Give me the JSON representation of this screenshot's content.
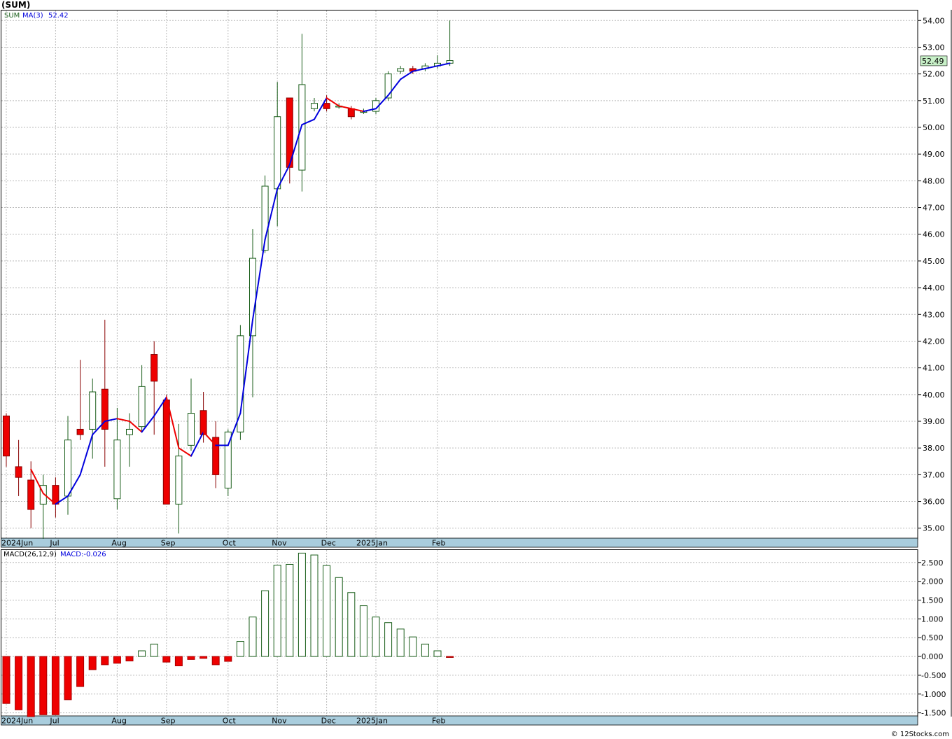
{
  "header": {
    "symbol": "(SUM)",
    "legend_symbol": "SUM",
    "legend_ma": "MA(3)",
    "legend_ma_value": "52.42",
    "last_price": "52.49",
    "macd_label": "MACD(26,12,9)",
    "macd_value_label": "MACD:-0.026"
  },
  "footer": {
    "credit": "© 12Stocks.com"
  },
  "colors": {
    "up_candle": "#ffffff",
    "up_outline": "#1a5e1a",
    "down_candle": "#ee0000",
    "ma_up": "#0000dd",
    "ma_down": "#ee0000",
    "macd_pos_outline": "#1a5e1a",
    "macd_neg": "#ee0000",
    "grid": "#bbbbbb",
    "date_strip": "#a9cddd",
    "last_price_box": "#c8f0c8"
  },
  "chart_data": [
    {
      "type": "candlestick",
      "title": "(SUM)",
      "xticks": [
        "2024Jun",
        "Jul",
        "Aug",
        "Sep",
        "Oct",
        "Nov",
        "Dec",
        "2025Jan",
        "Feb"
      ],
      "xtick_index": [
        0,
        4,
        9,
        13,
        18,
        22,
        26,
        30,
        35
      ],
      "ylim": [
        34.6,
        54.4
      ],
      "yticks": [
        "54.00",
        "53.00",
        "52.00",
        "51.00",
        "50.00",
        "49.00",
        "48.00",
        "47.00",
        "46.00",
        "45.00",
        "44.00",
        "43.00",
        "42.00",
        "41.00",
        "40.00",
        "39.00",
        "38.00",
        "37.00",
        "36.00",
        "35.00"
      ],
      "ohlc": [
        [
          39.2,
          39.3,
          37.3,
          37.7
        ],
        [
          37.3,
          38.3,
          36.2,
          36.9
        ],
        [
          36.8,
          37.5,
          35.0,
          35.7
        ],
        [
          35.9,
          37.0,
          34.6,
          36.6
        ],
        [
          36.6,
          36.9,
          35.4,
          35.9
        ],
        [
          36.2,
          39.2,
          35.5,
          38.3
        ],
        [
          38.7,
          41.3,
          38.3,
          38.5
        ],
        [
          38.7,
          40.6,
          37.6,
          40.1
        ],
        [
          40.2,
          42.8,
          37.3,
          38.7
        ],
        [
          36.1,
          39.5,
          35.7,
          38.3
        ],
        [
          38.5,
          39.3,
          37.3,
          38.7
        ],
        [
          38.8,
          41.1,
          38.6,
          40.3
        ],
        [
          41.5,
          42.0,
          38.5,
          40.5
        ],
        [
          39.8,
          40.0,
          35.9,
          35.9
        ],
        [
          35.9,
          38.9,
          34.8,
          37.7
        ],
        [
          38.1,
          40.6,
          37.9,
          39.3
        ],
        [
          39.4,
          40.1,
          38.2,
          38.5
        ],
        [
          38.4,
          39.0,
          36.5,
          37.0
        ],
        [
          36.5,
          38.7,
          36.2,
          38.6
        ],
        [
          38.6,
          42.6,
          38.3,
          42.2
        ],
        [
          42.2,
          46.2,
          39.9,
          45.1
        ],
        [
          45.4,
          48.2,
          45.3,
          47.8
        ],
        [
          47.7,
          51.7,
          46.3,
          50.4
        ],
        [
          51.1,
          51.1,
          47.9,
          48.5
        ],
        [
          48.4,
          53.5,
          47.6,
          51.6
        ],
        [
          50.7,
          51.1,
          50.6,
          50.9
        ],
        [
          50.9,
          51.2,
          50.6,
          50.7
        ],
        [
          50.8,
          50.9,
          50.7,
          50.8
        ],
        [
          50.7,
          50.8,
          50.3,
          50.4
        ],
        [
          50.6,
          50.7,
          50.5,
          50.6
        ],
        [
          50.6,
          51.1,
          50.5,
          51.0
        ],
        [
          51.1,
          52.1,
          51.0,
          52.0
        ],
        [
          52.1,
          52.3,
          52.0,
          52.2
        ],
        [
          52.2,
          52.3,
          52.0,
          52.1
        ],
        [
          52.2,
          52.4,
          52.1,
          52.3
        ],
        [
          52.3,
          52.7,
          52.2,
          52.4
        ],
        [
          52.4,
          54.0,
          52.3,
          52.5
        ]
      ],
      "ma3": [
        null,
        null,
        37.2,
        36.3,
        35.9,
        36.2,
        37.0,
        38.5,
        39.0,
        39.1,
        39.0,
        38.6,
        39.2,
        39.9,
        38.0,
        37.7,
        38.6,
        38.1,
        38.1,
        39.3,
        42.8,
        45.8,
        47.7,
        48.6,
        50.1,
        50.3,
        51.1,
        50.8,
        50.7,
        50.6,
        50.7,
        51.2,
        51.8,
        52.1,
        52.2,
        52.3,
        52.4
      ]
    },
    {
      "type": "bar",
      "title": "MACD(26,12,9)",
      "xticks": [
        "2024Jun",
        "Jul",
        "Aug",
        "Sep",
        "Oct",
        "Nov",
        "Dec",
        "2025Jan",
        "Feb"
      ],
      "xtick_index": [
        0,
        4,
        9,
        13,
        18,
        22,
        26,
        30,
        35
      ],
      "ylim": [
        -1.6,
        2.85
      ],
      "yticks": [
        "2.500",
        "2.000",
        "1.500",
        "1.000",
        "0.500",
        "0.000",
        "-0.500",
        "-1.000",
        "-1.500"
      ],
      "values": [
        -1.25,
        -1.42,
        -1.6,
        -1.55,
        -1.55,
        -1.15,
        -0.8,
        -0.35,
        -0.22,
        -0.18,
        -0.12,
        0.15,
        0.33,
        -0.15,
        -0.25,
        -0.08,
        -0.05,
        -0.22,
        -0.13,
        0.4,
        1.05,
        1.75,
        2.43,
        2.45,
        2.75,
        2.7,
        2.42,
        2.1,
        1.7,
        1.35,
        1.05,
        0.9,
        0.73,
        0.52,
        0.33,
        0.15,
        -0.026
      ]
    }
  ]
}
